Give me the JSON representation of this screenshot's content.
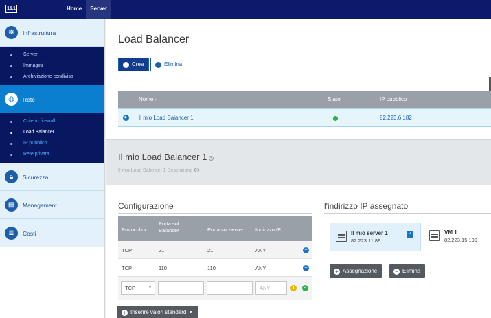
{
  "topbar": {
    "logo": "1&1",
    "nav": [
      "Home",
      "Server"
    ]
  },
  "sidebar": {
    "sections": [
      {
        "label": "Infrastruttura",
        "icon": "network-icon"
      },
      {
        "label": "Rete",
        "icon": "globe-icon"
      },
      {
        "label": "Sicurezza",
        "icon": "lock-icon"
      },
      {
        "label": "Management",
        "icon": "clipboard-icon"
      },
      {
        "label": "Costi",
        "icon": "invoice-icon"
      }
    ],
    "infra_items": [
      "Server",
      "Immagini",
      "Archiviazione condivisa"
    ],
    "rete_items": [
      "Criterio firewall",
      "Load Balancer",
      "IP pubblico",
      "Rete privata"
    ]
  },
  "main": {
    "title": "Load Balancer",
    "create_label": "Crea",
    "delete_label": "Elimina",
    "grid": {
      "columns": [
        "Nome",
        "Stato",
        "IP pubblico"
      ],
      "rows": [
        {
          "name": "Il mio Load Balancer 1",
          "ip": "82.223.6.182"
        }
      ]
    },
    "detail": {
      "title": "Il mio Load Balancer 1",
      "description": "Il mio Load Balancer 1 Descrizione"
    },
    "config": {
      "title": "Configurazione",
      "columns": [
        "Protocollo",
        "Porta sul Balancer",
        "Porta sui server",
        "Indirizzo IP"
      ],
      "rows": [
        {
          "protocol": "TCP",
          "lb_port": "21",
          "server_port": "21",
          "ip": "ANY"
        },
        {
          "protocol": "TCP",
          "lb_port": "110",
          "server_port": "110",
          "ip": "ANY"
        }
      ],
      "new_row": {
        "protocol": "TCP",
        "ip_placeholder": "ANY"
      },
      "defaults_button": "Inserire valori standard"
    },
    "assigned": {
      "title": "l'indirizzo IP assegnato",
      "servers": [
        {
          "name": "Il mio server 1",
          "ip": "82.223.11.89"
        },
        {
          "name": "VM 1",
          "ip": "82.223.15.199"
        }
      ],
      "assign_label": "Assegnazione",
      "remove_label": "Elimina"
    }
  },
  "colors": {
    "topbar": "#0b1a6b",
    "active_section": "#0a7fd0",
    "submenu": "#071861",
    "status_ok": "#2db14a",
    "warning": "#f2b400"
  }
}
